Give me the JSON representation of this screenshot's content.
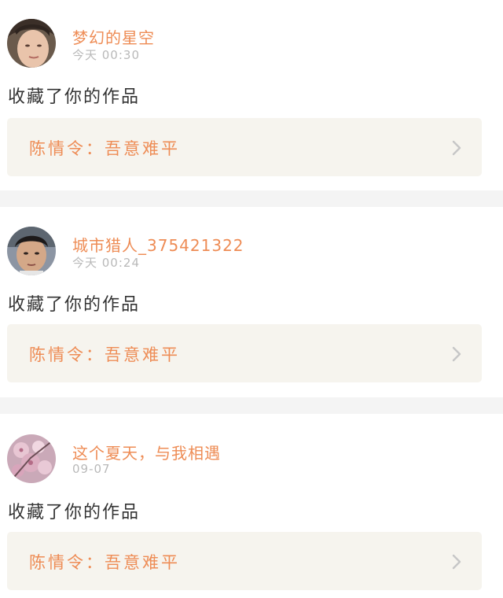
{
  "feed": {
    "items": [
      {
        "user_name": "梦幻的星空",
        "time": "今天 00:30",
        "action": "收藏了你的作品",
        "work_title": "陈情令：吾意难平",
        "avatar_icon": "boy-portrait-avatar"
      },
      {
        "user_name": "城市猎人_375421322",
        "time": "今天 00:24",
        "action": "收藏了你的作品",
        "work_title": "陈情令：吾意难平",
        "avatar_icon": "boy-portrait-avatar"
      },
      {
        "user_name": "这个夏天，与我相遇",
        "time": "09-07",
        "action": "收藏了你的作品",
        "work_title": "陈情令：吾意难平",
        "avatar_icon": "cherry-blossom-avatar"
      }
    ]
  },
  "colors": {
    "accent": "#ee8c55",
    "card_background": "#f6f4ee",
    "separator": "#f4f4f4",
    "muted_text": "#b9b9b9"
  }
}
